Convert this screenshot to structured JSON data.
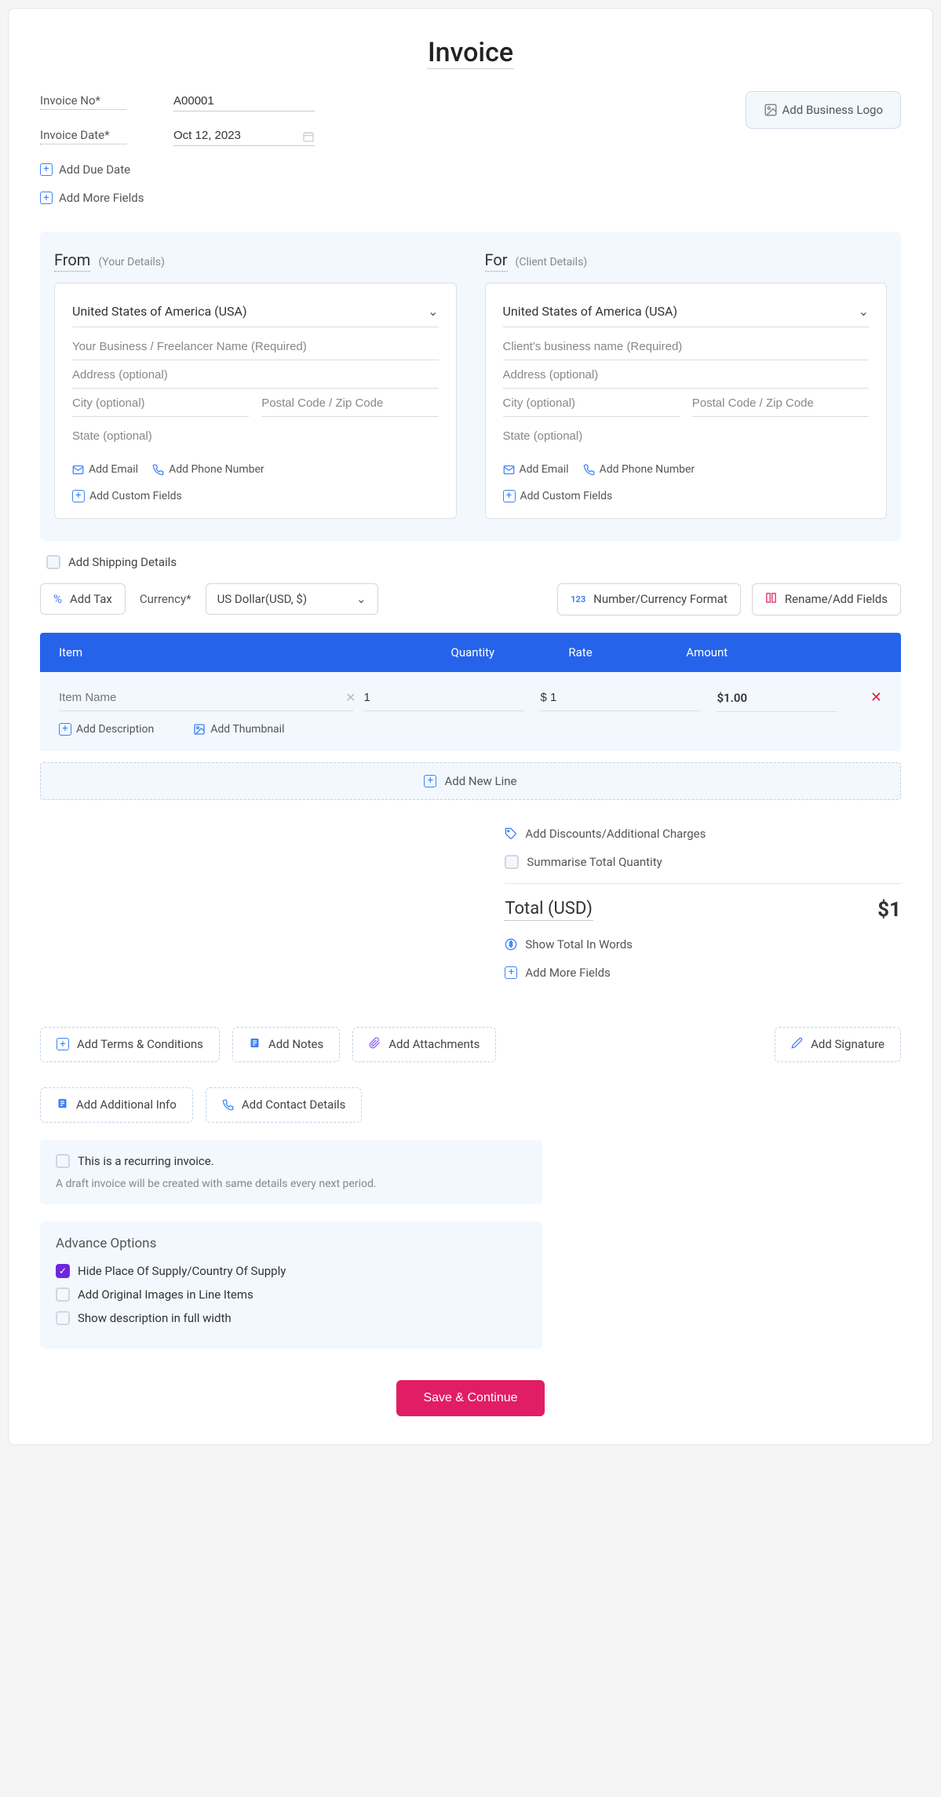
{
  "title": "Invoice",
  "meta": {
    "invoice_no_label": "Invoice No*",
    "invoice_no_value": "A00001",
    "invoice_date_label": "Invoice Date*",
    "invoice_date_value": "Oct 12, 2023",
    "add_due_date": "Add Due Date",
    "add_more_fields": "Add More Fields"
  },
  "logo_btn": "Add Business Logo",
  "from": {
    "heading": "From",
    "sub": "(Your Details)",
    "country": "United States of America (USA)",
    "name_ph": "Your Business / Freelancer Name (Required)",
    "address_ph": "Address (optional)",
    "city_ph": "City (optional)",
    "postal_ph": "Postal Code / Zip Code",
    "state_ph": "State (optional)",
    "add_email": "Add Email",
    "add_phone": "Add Phone Number",
    "add_custom": "Add Custom Fields"
  },
  "for": {
    "heading": "For",
    "sub": "(Client Details)",
    "country": "United States of America (USA)",
    "name_ph": "Client's business name (Required)",
    "address_ph": "Address (optional)",
    "city_ph": "City (optional)",
    "postal_ph": "Postal Code / Zip Code",
    "state_ph": "State (optional)",
    "add_email": "Add Email",
    "add_phone": "Add Phone Number",
    "add_custom": "Add Custom Fields"
  },
  "shipping": "Add Shipping Details",
  "toolbar": {
    "add_tax": "Add Tax",
    "currency_label": "Currency*",
    "currency_value": "US Dollar(USD, $)",
    "num_format": "Number/Currency Format",
    "rename_fields": "Rename/Add Fields"
  },
  "table": {
    "h_item": "Item",
    "h_qty": "Quantity",
    "h_rate": "Rate",
    "h_amt": "Amount",
    "row": {
      "name_ph": "Item Name",
      "qty": "1",
      "rate": "$ 1",
      "amount": "$1.00"
    },
    "add_desc": "Add Description",
    "add_thumb": "Add Thumbnail",
    "add_line": "Add New Line"
  },
  "summary": {
    "discounts": "Add Discounts/Additional Charges",
    "summarise": "Summarise Total Quantity",
    "total_label": "Total (USD)",
    "total_amount": "$1",
    "total_words": "Show Total In Words",
    "more_fields": "Add More Fields"
  },
  "buttons": {
    "terms": "Add Terms & Conditions",
    "notes": "Add Notes",
    "attachments": "Add Attachments",
    "signature": "Add Signature",
    "additional": "Add Additional Info",
    "contact": "Add Contact Details"
  },
  "recurring": {
    "label": "This is a recurring invoice.",
    "sub": "A draft invoice will be created with same details every next period."
  },
  "advance": {
    "title": "Advance Options",
    "opt1": "Hide Place Of Supply/Country Of Supply",
    "opt2": "Add Original Images in Line Items",
    "opt3": "Show description in full width"
  },
  "save": "Save & Continue"
}
